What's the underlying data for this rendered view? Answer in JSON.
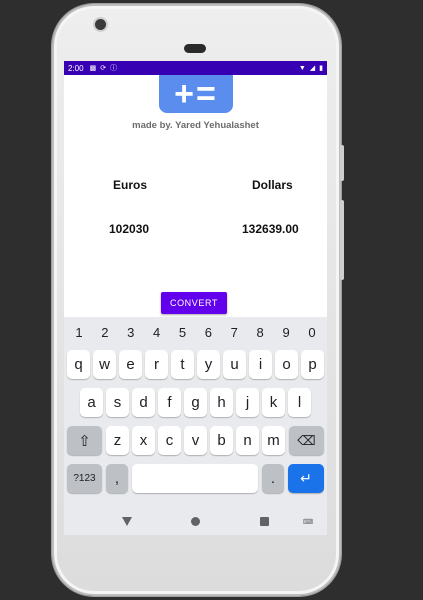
{
  "status_bar": {
    "time": "2:00",
    "left_icons": [
      "notification-icon",
      "sync-icon",
      "info-icon"
    ],
    "right_icons": [
      "wifi-icon",
      "signal-icon",
      "battery-icon"
    ]
  },
  "app": {
    "logo_symbol": "+=",
    "made_by": "made by. Yared Yehualashet",
    "euros_label": "Euros",
    "dollars_label": "Dollars",
    "euros_value": "102030",
    "dollars_value": "132639.00",
    "convert_label": "CONVERT",
    "accent_color": "#6200ee",
    "status_bar_color": "#3700b3",
    "logo_color": "#5b8def"
  },
  "keyboard": {
    "number_row": [
      "1",
      "2",
      "3",
      "4",
      "5",
      "6",
      "7",
      "8",
      "9",
      "0"
    ],
    "row1": [
      "q",
      "w",
      "e",
      "r",
      "t",
      "y",
      "u",
      "i",
      "o",
      "p"
    ],
    "row2": [
      "a",
      "s",
      "d",
      "f",
      "g",
      "h",
      "j",
      "k",
      "l"
    ],
    "row3": [
      "z",
      "x",
      "c",
      "v",
      "b",
      "n",
      "m"
    ],
    "symbols_label": "?123",
    "comma": ",",
    "period": ".",
    "enter_color": "#1a73e8"
  },
  "nav_icons": [
    "back-icon",
    "home-icon",
    "recents-icon",
    "keyboard-switch-icon"
  ]
}
